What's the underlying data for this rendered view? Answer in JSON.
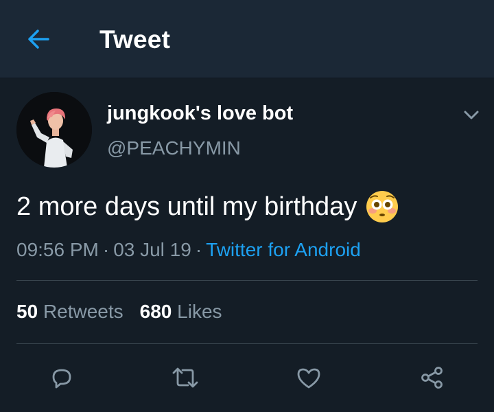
{
  "header": {
    "title": "Tweet",
    "back_icon": "arrow-left-icon",
    "accent": "#1da1f2"
  },
  "tweet": {
    "display_name": "jungkook's love bot",
    "handle": "@PEACHYMIN",
    "text": "2 more days until my birthday",
    "emoji": "flushed-face-emoji",
    "time": "09:56 PM",
    "date": "03 Jul 19",
    "source": "Twitter for Android",
    "retweets_count": "50",
    "retweets_label": "Retweets",
    "likes_count": "680",
    "likes_label": "Likes"
  },
  "actions": [
    {
      "name": "reply",
      "icon": "reply-icon"
    },
    {
      "name": "retweet",
      "icon": "retweet-icon"
    },
    {
      "name": "like",
      "icon": "heart-icon"
    },
    {
      "name": "share",
      "icon": "share-icon"
    }
  ],
  "colors": {
    "background": "#141d26",
    "header_bg": "#1b2836",
    "secondary_text": "#8899a6",
    "link": "#1da1f2",
    "divider": "#38444d"
  }
}
